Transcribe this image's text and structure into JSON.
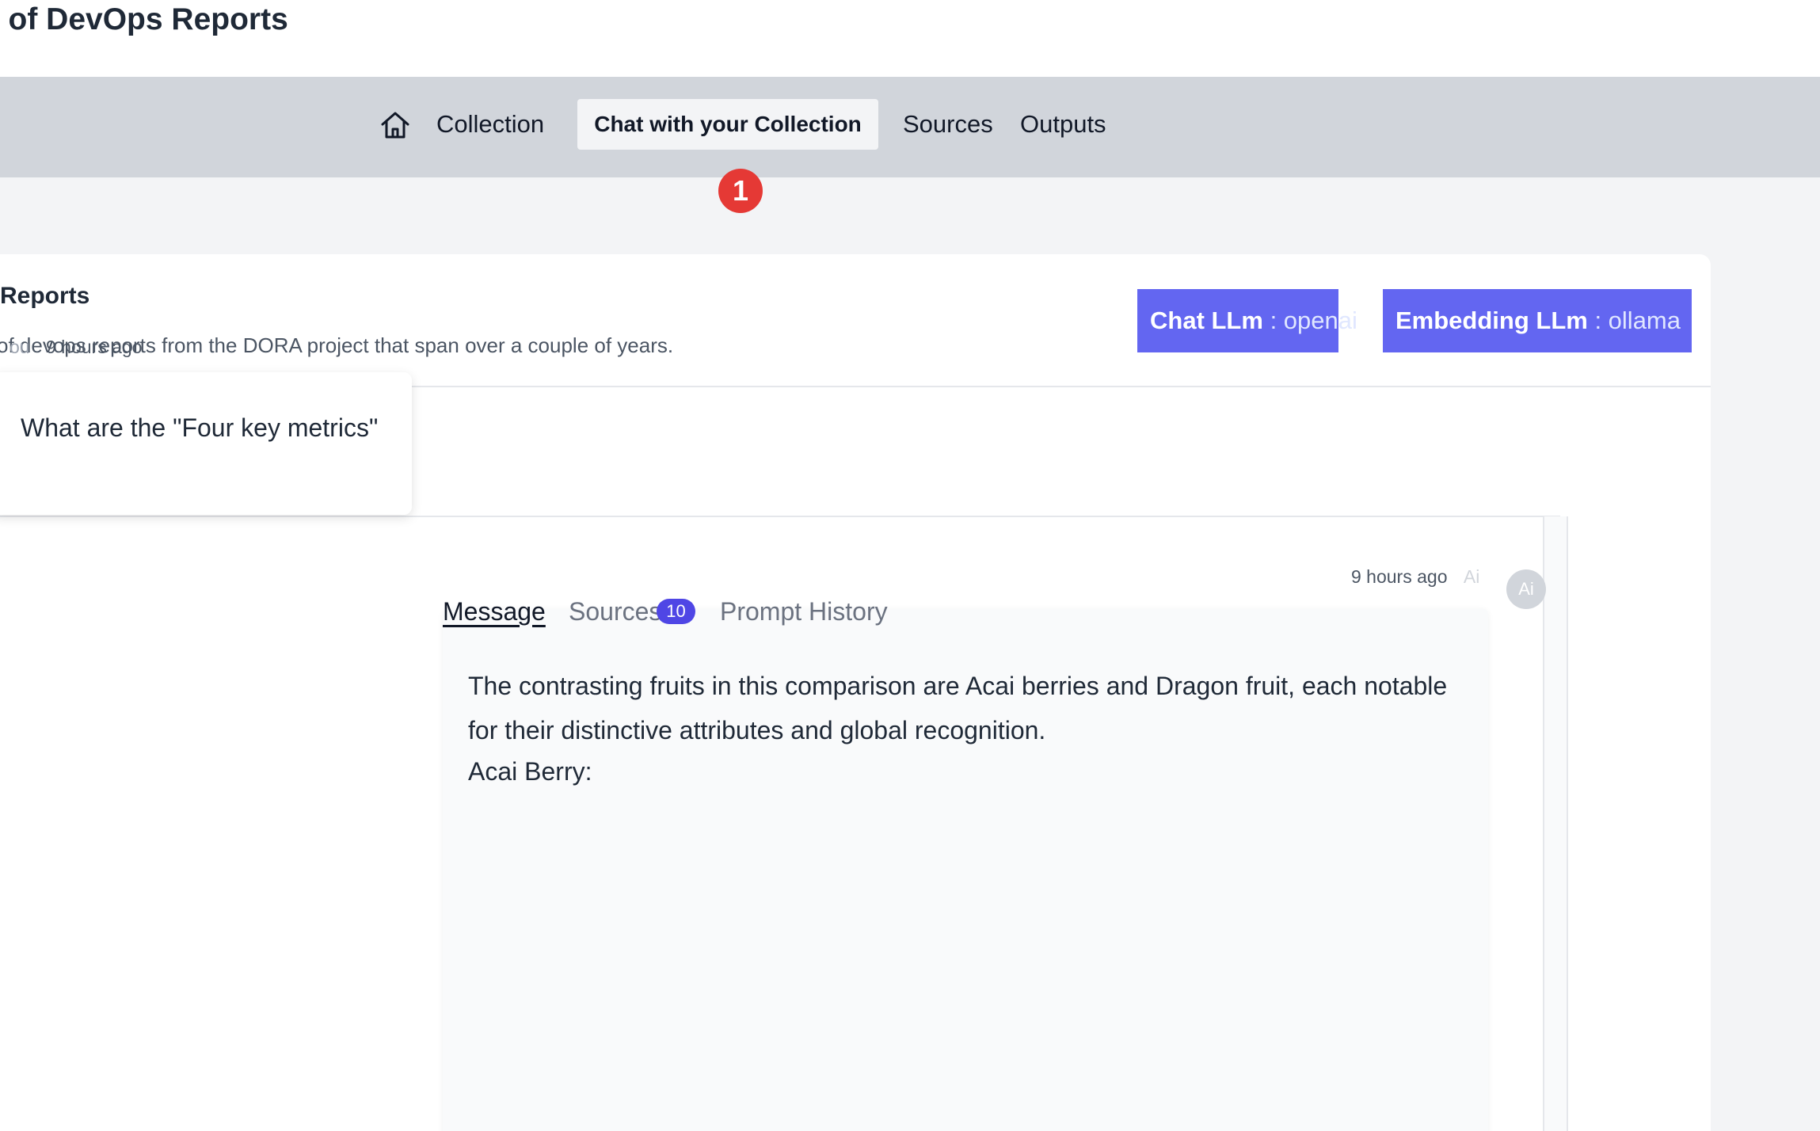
{
  "header": {
    "title": "e of DevOps Reports"
  },
  "nav": {
    "home_icon": "home-icon",
    "collection": "Collection",
    "chat": "Chat with your Collection",
    "sources": "Sources",
    "outputs": "Outputs"
  },
  "marker": {
    "label": "1",
    "color": "#e53935"
  },
  "collection": {
    "name": "Reports",
    "description": "of devops reports from the DORA project that span over a couple of years."
  },
  "llm": {
    "chat_key": "Chat LLm",
    "chat_value": ": openai",
    "embed_key": "Embedding LLm",
    "embed_value": ": ollama",
    "accent": "#6366f1"
  },
  "messages": {
    "user": {
      "who": "ou",
      "time": "9 hours ago",
      "text": "What are the \"Four key metrics\""
    },
    "ai": {
      "time": "9 hours ago",
      "who": "Ai",
      "avatar": "Ai",
      "tabs": {
        "message": "Message",
        "sources": "Sources",
        "sources_count": "10",
        "history": "Prompt History"
      },
      "paragraph": "The contrasting fruits in this comparison are Acai berries and Dragon fruit, each notable for their distinctive attributes and global recognition.",
      "line2": "Acai Berry:"
    }
  }
}
